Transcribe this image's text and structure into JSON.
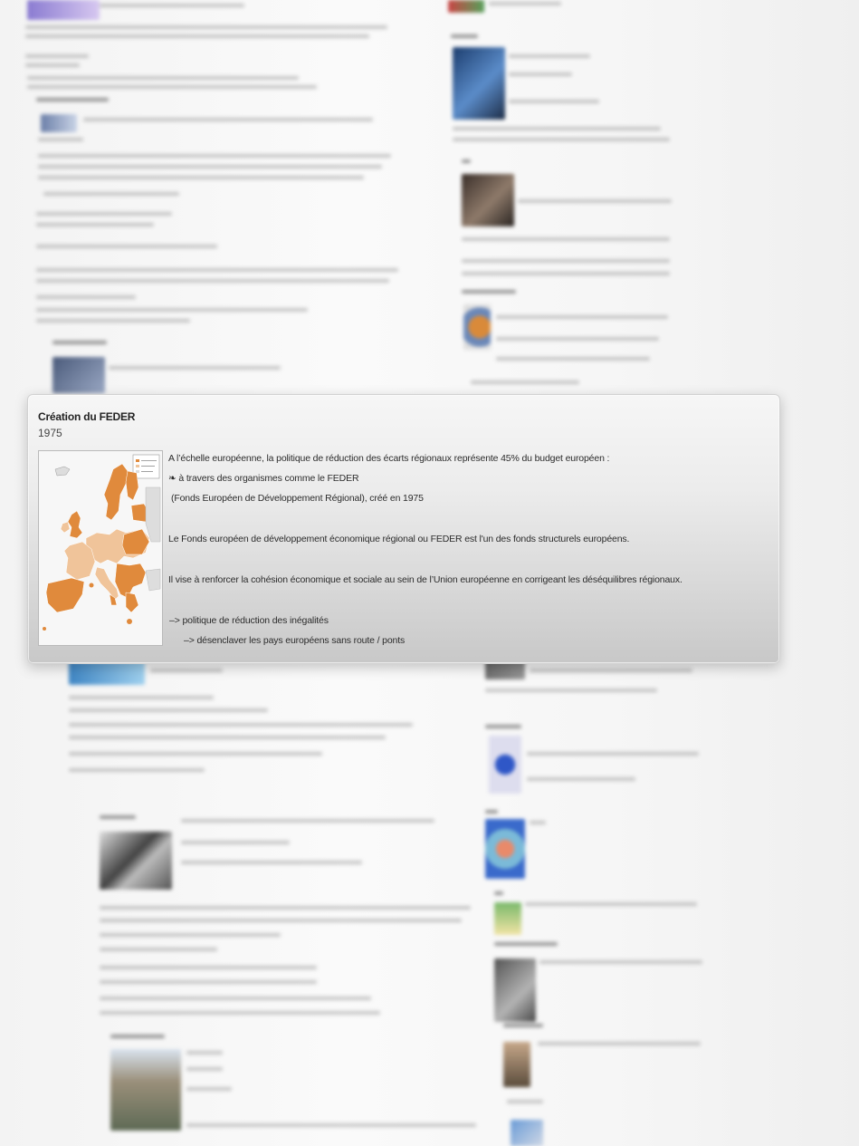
{
  "event": {
    "title": "Création du FEDER",
    "date": "1975",
    "body": {
      "line1": "A l’échelle européenne, la politique de réduction des écarts régionaux représente 45% du budget européen :",
      "line2": "❧ à travers des organismes comme le FEDER",
      "line3": "(Fonds Européen de Développement Régional), créé en 1975",
      "line4": "Le Fonds européen de développement économique régional ou FEDER est l'un des fonds structurels européens.",
      "line5": "Il vise à renforcer la cohésion économique et sociale au sein de l’Union européenne en corrigeant les déséquilibres régionaux.",
      "line6": "–> politique de réduction des inégalités",
      "line7": "–> désenclaver les pays européens sans route / ponts"
    },
    "image": {
      "subject": "map of European regions (FEDER)",
      "accent_color": "#e08a3c"
    }
  },
  "colors": {
    "card_top": "#f6f6f6",
    "card_bottom": "#c8c8c8",
    "text": "#2c2c2c",
    "map_fill": "#e08a3c"
  }
}
